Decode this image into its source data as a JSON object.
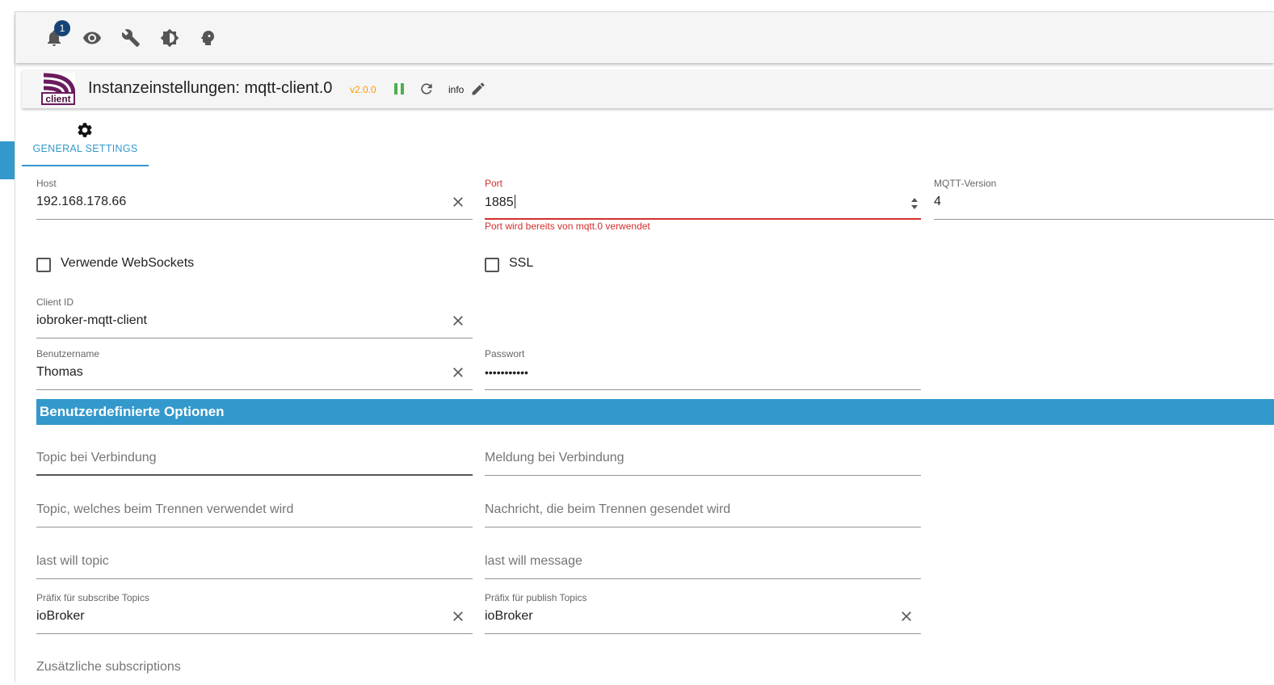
{
  "topbar": {
    "notification_count": "1",
    "icons": [
      "bell-icon",
      "eye-icon",
      "wrench-icon",
      "brightness-icon",
      "expert-head-icon"
    ]
  },
  "header": {
    "title": "Instanzeinstellungen: mqtt-client.0",
    "version": "v2.0.0",
    "info_label": "info",
    "logo_text": "client"
  },
  "tabs": [
    {
      "label": "GENERAL SETTINGS"
    }
  ],
  "fields": {
    "host": {
      "label": "Host",
      "value": "192.168.178.66"
    },
    "port": {
      "label": "Port",
      "value": "1885",
      "error": "Port wird bereits von mqtt.0 verwendet"
    },
    "mqtt_version": {
      "label": "MQTT-Version",
      "value": "4"
    },
    "websockets": {
      "label": "Verwende WebSockets",
      "checked": false
    },
    "ssl": {
      "label": "SSL",
      "checked": false
    },
    "client_id": {
      "label": "Client ID",
      "value": "iobroker-mqtt-client"
    },
    "username": {
      "label": "Benutzername",
      "value": "Thomas"
    },
    "password": {
      "label": "Passwort",
      "value": "•••••••••••"
    }
  },
  "section": {
    "title": "Benutzerdefinierte Optionen"
  },
  "custom": {
    "connect_topic": {
      "placeholder": "Topic bei Verbindung"
    },
    "connect_message": {
      "placeholder": "Meldung bei Verbindung"
    },
    "disconnect_topic": {
      "placeholder": "Topic, welches beim Trennen verwendet wird"
    },
    "disconnect_message": {
      "placeholder": "Nachricht, die beim Trennen gesendet wird"
    },
    "last_will_topic": {
      "placeholder": "last will topic"
    },
    "last_will_message": {
      "placeholder": "last will message"
    },
    "subscribe_prefix": {
      "label": "Präfix für subscribe Topics",
      "value": "ioBroker"
    },
    "publish_prefix": {
      "label": "Präfix für publish Topics",
      "value": "ioBroker"
    },
    "extra_subscriptions": {
      "placeholder": "Zusätzliche subscriptions"
    }
  },
  "colors": {
    "accent": "#3399cc",
    "error": "#d32f2f",
    "version": "#ff9900",
    "badge": "#164477",
    "running": "#4caf50"
  }
}
